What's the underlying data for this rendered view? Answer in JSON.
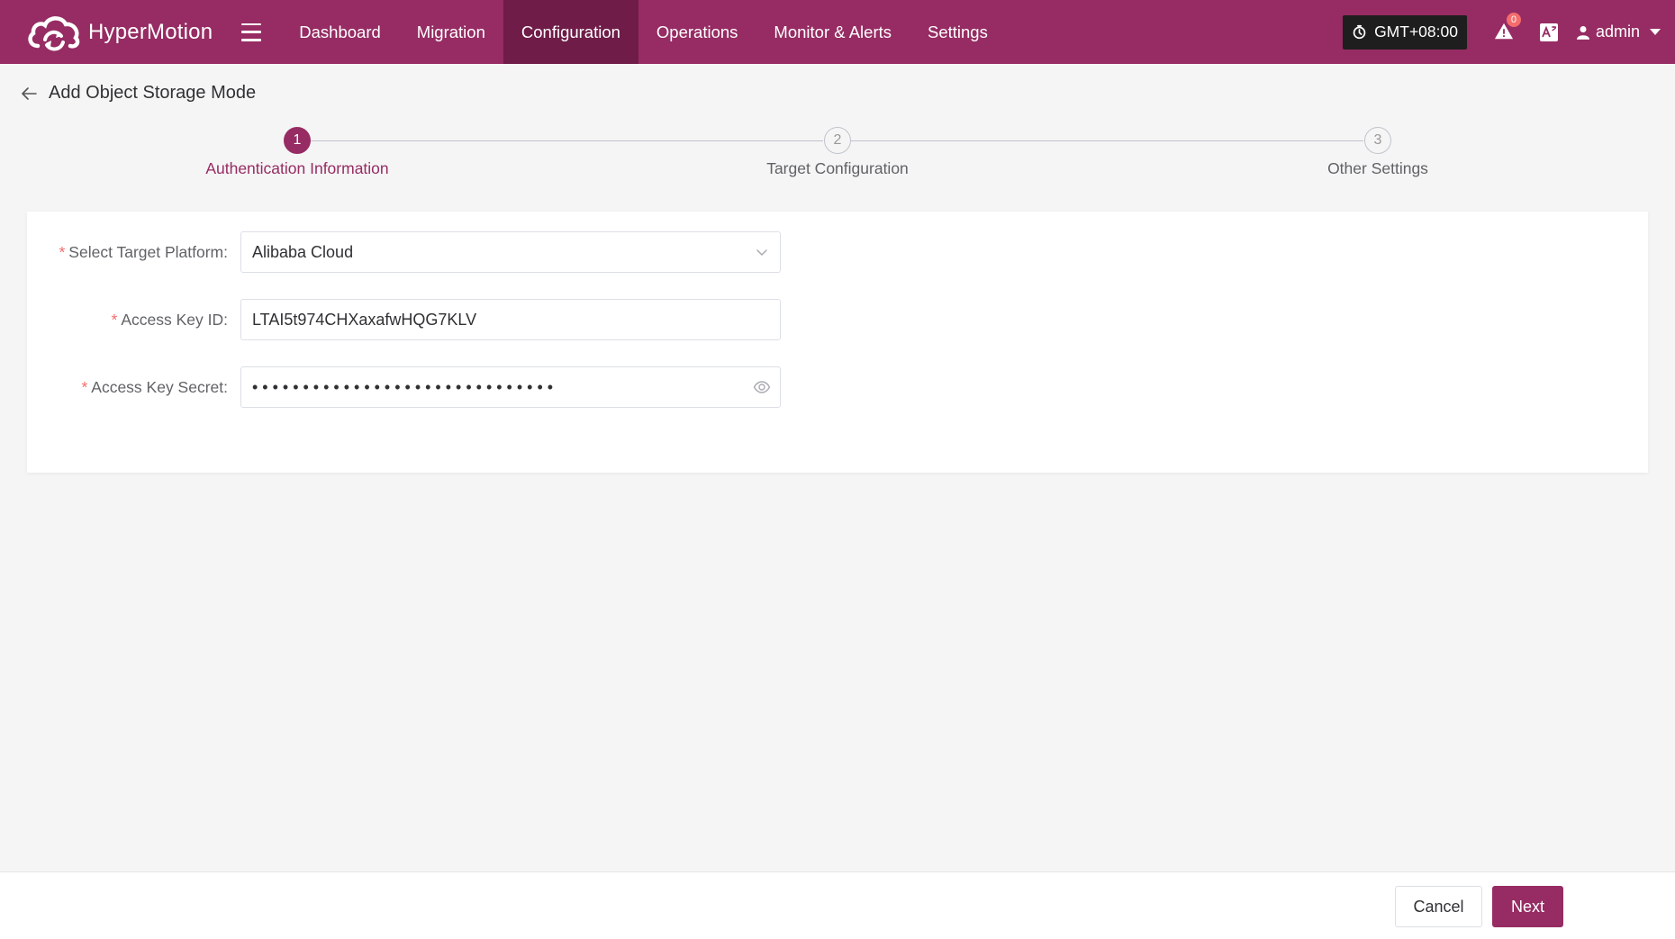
{
  "app": {
    "name": "HyperMotion"
  },
  "nav": {
    "items": [
      {
        "label": "Dashboard",
        "active": false
      },
      {
        "label": "Migration",
        "active": false
      },
      {
        "label": "Configuration",
        "active": true
      },
      {
        "label": "Operations",
        "active": false
      },
      {
        "label": "Monitor & Alerts",
        "active": false
      },
      {
        "label": "Settings",
        "active": false
      }
    ]
  },
  "header_right": {
    "timezone": "GMT+08:00",
    "alert_count": "0",
    "user": "admin"
  },
  "page": {
    "title": "Add Object Storage Mode"
  },
  "steps": [
    {
      "number": "1",
      "label": "Authentication Information",
      "active": true
    },
    {
      "number": "2",
      "label": "Target Configuration",
      "active": false
    },
    {
      "number": "3",
      "label": "Other Settings",
      "active": false
    }
  ],
  "form": {
    "required_mark": "*",
    "platform": {
      "label": "Select Target Platform:",
      "value": "Alibaba Cloud"
    },
    "access_key_id": {
      "label": "Access Key ID:",
      "value": "LTAI5t974CHXaxafwHQG7KLV"
    },
    "access_key_secret": {
      "label": "Access Key Secret:",
      "masked_value": "••••••••••••••••••••••••••••••"
    }
  },
  "footer": {
    "cancel_label": "Cancel",
    "next_label": "Next"
  },
  "colors": {
    "brand": "#962c63",
    "nav_active": "#6f1c48",
    "required": "#f56c6c"
  },
  "icons": {
    "logo": "cloud-sync-logo-icon",
    "menu": "hamburger-menu-icon",
    "timezone": "clock-icon",
    "alerts": "warning-triangle-icon",
    "language": "translate-icon",
    "user": "user-icon",
    "back": "arrow-left-icon",
    "select": "chevron-down-icon",
    "password": "eye-icon"
  }
}
